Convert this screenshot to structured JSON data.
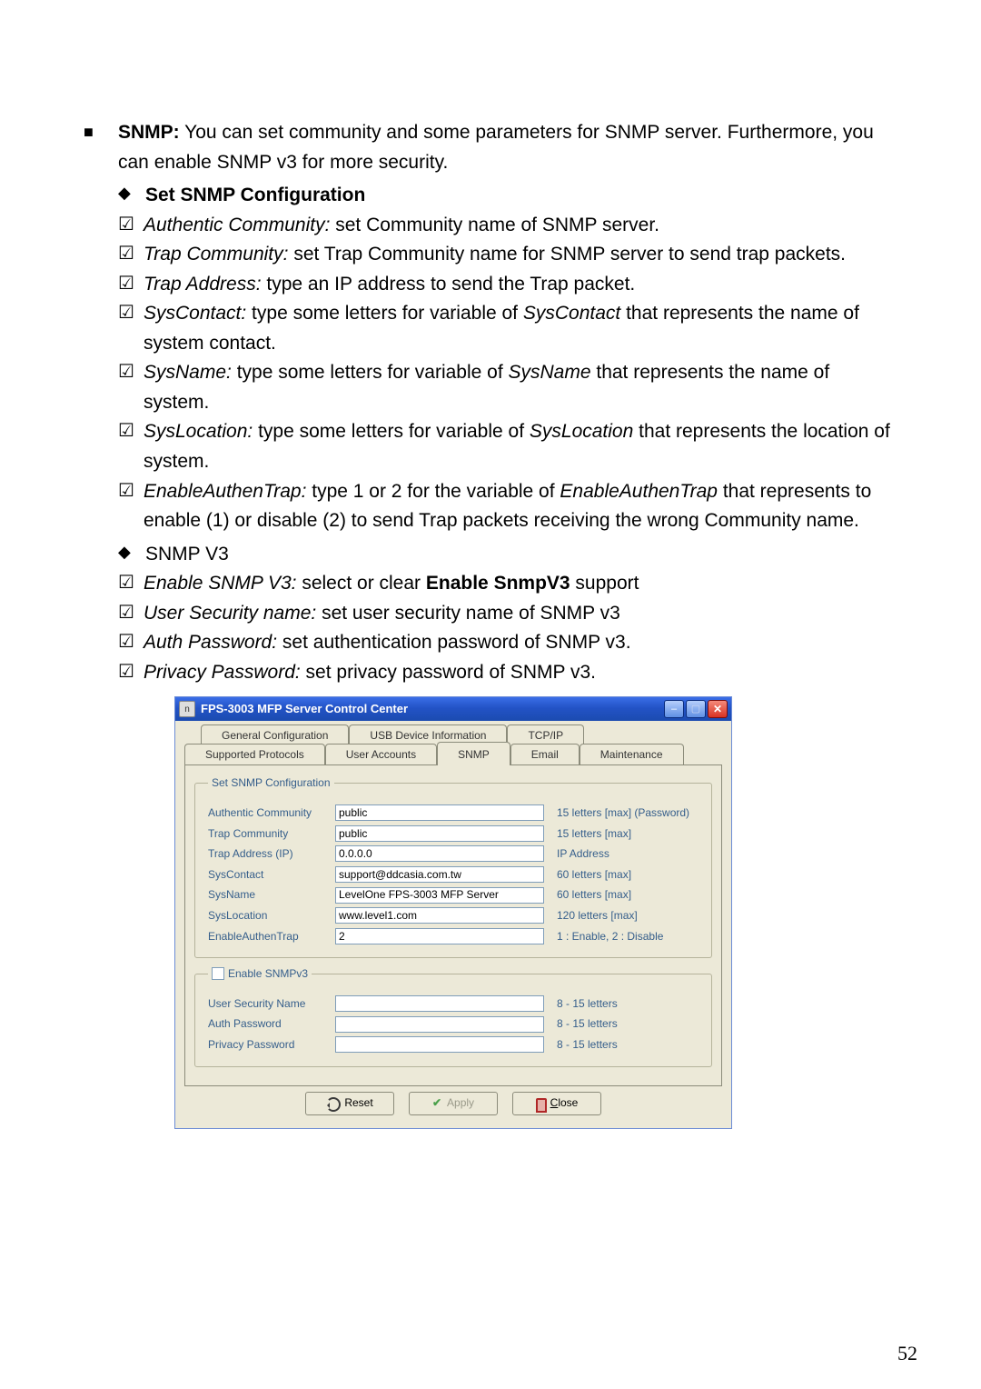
{
  "doc": {
    "snmp_label": "SNMP:",
    "snmp_intro": " You can set community and some parameters for SNMP server. Furthermore, you can enable SNMP v3 for more security.",
    "set_heading": "Set SNMP Configuration",
    "items": {
      "auth_comm_term": "Authentic Community:",
      "auth_comm_desc": " set Community name of SNMP server.",
      "trap_comm_term": "Trap Community:",
      "trap_comm_desc": " set Trap Community name for SNMP server to send trap packets.",
      "trap_addr_term": "Trap Address:",
      "trap_addr_desc": " type an IP address to send the Trap packet.",
      "syscontact_term": "SysContact:",
      "syscontact_desc1": " type some letters for variable of ",
      "syscontact_var": "SysContact",
      "syscontact_desc2": " that represents the name of system contact.",
      "sysname_term": "SysName:",
      "sysname_desc1": " type some letters for variable of ",
      "sysname_var": "SysName",
      "sysname_desc2": " that represents the name of system.",
      "sysloc_term": "SysLocation:",
      "sysloc_desc1": " type some letters for variable of ",
      "sysloc_var": "SysLocation",
      "sysloc_desc2": " that represents the location of system.",
      "eat_term": "EnableAuthenTrap:",
      "eat_desc1": " type 1 or 2 for the variable of ",
      "eat_var": "EnableAuthenTrap",
      "eat_desc2": " that represents to enable (1) or disable (2) to send Trap packets receiving the wrong Community name."
    },
    "snmpv3_heading": "SNMP V3",
    "v3": {
      "enable_term": "Enable SNMP V3:",
      "enable_desc_a": " select or clear ",
      "enable_bold": "Enable SnmpV3",
      "enable_desc_b": " support",
      "usn_term": "User Security name:",
      "usn_desc": " set user security name of SNMP v3",
      "auth_term": "Auth Password:",
      "auth_desc": " set authentication password of SNMP v3.",
      "priv_term": "Privacy Password:",
      "priv_desc": " set privacy password of SNMP v3."
    },
    "page_number": "52"
  },
  "dialog": {
    "title": "FPS-3003 MFP Server Control Center",
    "tabs_back": [
      "General Configuration",
      "USB Device Information",
      "TCP/IP"
    ],
    "tabs_front": [
      "Supported Protocols",
      "User Accounts",
      "SNMP",
      "Email",
      "Maintenance"
    ],
    "group1_legend": "Set SNMP Configuration",
    "fields": {
      "auth_comm": {
        "label": "Authentic Community",
        "value": "public",
        "hint": "15 letters [max] (Password)"
      },
      "trap_comm": {
        "label": "Trap Community",
        "value": "public",
        "hint": "15 letters [max]"
      },
      "trap_addr": {
        "label": "Trap Address (IP)",
        "value": "0.0.0.0",
        "hint": "IP Address"
      },
      "syscontact": {
        "label": "SysContact",
        "value": "support@ddcasia.com.tw",
        "hint": "60 letters [max]"
      },
      "sysname": {
        "label": "SysName",
        "value": "LevelOne FPS-3003 MFP Server",
        "hint": "60 letters [max]"
      },
      "syslocation": {
        "label": "SysLocation",
        "value": "www.level1.com",
        "hint": "120 letters [max]"
      },
      "eat": {
        "label": "EnableAuthenTrap",
        "value": "2",
        "hint": "1 : Enable, 2 : Disable"
      }
    },
    "group2_legend": "Enable SNMPv3",
    "v3fields": {
      "usn": {
        "label": "User Security Name",
        "value": "",
        "hint": "8 - 15 letters"
      },
      "auth": {
        "label": "Auth Password",
        "value": "",
        "hint": "8 - 15 letters"
      },
      "priv": {
        "label": "Privacy Password",
        "value": "",
        "hint": "8 - 15 letters"
      }
    },
    "buttons": {
      "reset": "Reset",
      "apply": "Apply",
      "close_pre": "C",
      "close_rest": "lose"
    }
  }
}
